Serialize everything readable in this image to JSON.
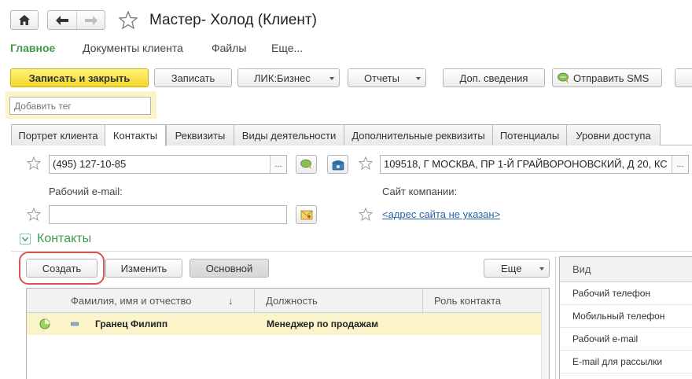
{
  "window": {
    "title": "Мастер- Холод (Клиент)",
    "icons": {
      "home": "home-icon",
      "back": "arrow-left-icon",
      "forward": "arrow-right-icon",
      "favorite": "star-icon"
    }
  },
  "sections": [
    {
      "label": "Главное",
      "active": true
    },
    {
      "label": "Документы клиента",
      "active": false
    },
    {
      "label": "Файлы",
      "active": false
    },
    {
      "label": "Еще...",
      "active": false
    }
  ],
  "toolbar": {
    "save_close": "Записать и закрыть",
    "save": "Записать",
    "lik": "ЛИК:Бизнес",
    "reports": "Отчеты",
    "extra_info": "Доп. сведения",
    "send_sms": "Отправить SMS"
  },
  "tag": {
    "placeholder": "Добавить тег"
  },
  "tabs": [
    {
      "label": "Портрет клиента",
      "active": false
    },
    {
      "label": "Контакты",
      "active": true
    },
    {
      "label": "Реквизиты",
      "active": false
    },
    {
      "label": "Виды деятельности",
      "active": false
    },
    {
      "label": "Дополнительные реквизиты",
      "active": false
    },
    {
      "label": "Потенциалы",
      "active": false
    },
    {
      "label": "Уровни доступа",
      "active": false
    }
  ],
  "contact_fields": {
    "phone": "(495) 127-10-85",
    "address": "109518, Г МОСКВА, ПР 1-Й ГРАЙВОРОНОВСКИЙ, Д 20, КС",
    "work_email_label": "Рабочий e-mail:",
    "work_email": "",
    "website_label": "Сайт компании:",
    "website_link": "<адрес сайта не указан>",
    "ellipsis": "..."
  },
  "contacts_group": {
    "title": "Контакты",
    "buttons": {
      "create": "Создать",
      "edit": "Изменить",
      "main": "Основной",
      "more": "Еще"
    },
    "columns": [
      "Фамилия, имя и отчество",
      "Должность",
      "Роль контакта"
    ],
    "sort_indicator": "↓",
    "rows": [
      {
        "name": "Гранец Филипп",
        "position": "Менеджер по продажам",
        "role": ""
      }
    ]
  },
  "side_list": {
    "header": "Вид",
    "items": [
      "Рабочий телефон",
      "Мобильный телефон",
      "Рабочий e-mail",
      "E-mail для рассылки"
    ]
  },
  "colors": {
    "accent_green": "#3c9a4a",
    "primary_yellow": "#f4d728",
    "row_highlight": "#fbf3c9",
    "ring_red": "#d9534f"
  }
}
